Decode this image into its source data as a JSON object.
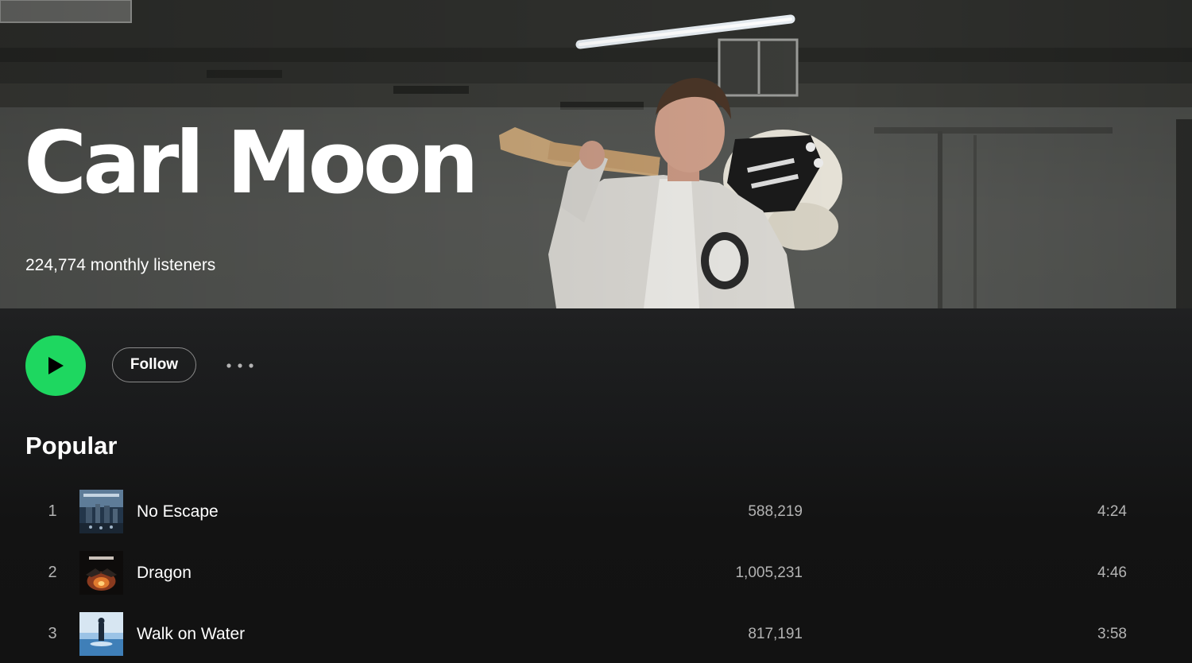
{
  "artist": {
    "name": "Carl Moon",
    "monthly_listeners": "224,774 monthly listeners"
  },
  "actions": {
    "play_icon": "play-icon",
    "follow_label": "Follow",
    "more_icon": "more-options-icon"
  },
  "popular": {
    "title": "Popular",
    "tracks": [
      {
        "number": "1",
        "title": "No Escape",
        "plays": "588,219",
        "duration": "4:24"
      },
      {
        "number": "2",
        "title": "Dragon",
        "plays": "1,005,231",
        "duration": "4:46"
      },
      {
        "number": "3",
        "title": "Walk on Water",
        "plays": "817,191",
        "duration": "3:58"
      }
    ]
  },
  "colors": {
    "accent": "#1ed760",
    "background": "#121212",
    "secondary_text": "#b3b3b3"
  }
}
